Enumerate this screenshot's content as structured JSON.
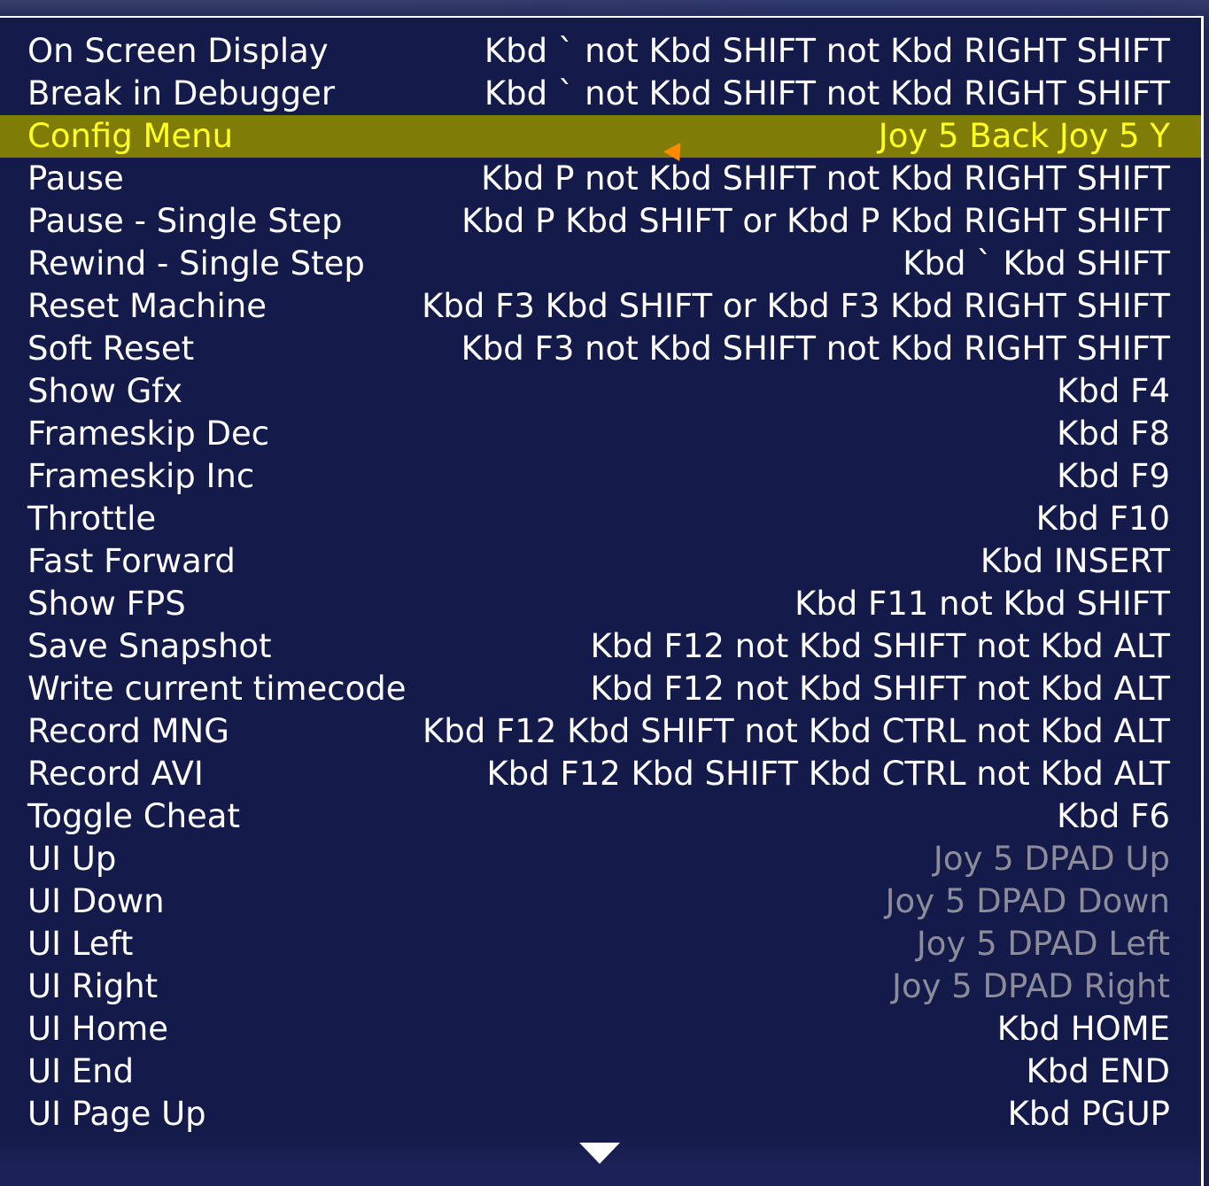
{
  "colors": {
    "panel_bg": "#141a49",
    "text": "#ffffff",
    "selected_bg": "#7f7d08",
    "selected_text": "#ffff22",
    "unassigned_text": "#8c8c9a",
    "pointer": "#ff8a00"
  },
  "menu": {
    "selected_index": 2,
    "items": [
      {
        "name": "On Screen Display",
        "binding": "Kbd ` not Kbd SHIFT not Kbd RIGHT SHIFT",
        "dim": false
      },
      {
        "name": "Break in Debugger",
        "binding": "Kbd ` not Kbd SHIFT not Kbd RIGHT SHIFT",
        "dim": false
      },
      {
        "name": "Config Menu",
        "binding": "Joy 5 Back Joy 5 Y",
        "dim": false
      },
      {
        "name": "Pause",
        "binding": "Kbd P not Kbd SHIFT not Kbd RIGHT SHIFT",
        "dim": false
      },
      {
        "name": "Pause - Single Step",
        "binding": "Kbd P Kbd SHIFT or Kbd P Kbd RIGHT SHIFT",
        "dim": false
      },
      {
        "name": "Rewind - Single Step",
        "binding": "Kbd ` Kbd SHIFT",
        "dim": false
      },
      {
        "name": "Reset Machine",
        "binding": "Kbd F3 Kbd SHIFT or Kbd F3 Kbd RIGHT SHIFT",
        "dim": false
      },
      {
        "name": "Soft Reset",
        "binding": "Kbd F3 not Kbd SHIFT not Kbd RIGHT SHIFT",
        "dim": false
      },
      {
        "name": "Show Gfx",
        "binding": "Kbd F4",
        "dim": false
      },
      {
        "name": "Frameskip Dec",
        "binding": "Kbd F8",
        "dim": false
      },
      {
        "name": "Frameskip Inc",
        "binding": "Kbd F9",
        "dim": false
      },
      {
        "name": "Throttle",
        "binding": "Kbd F10",
        "dim": false
      },
      {
        "name": "Fast Forward",
        "binding": "Kbd INSERT",
        "dim": false
      },
      {
        "name": "Show FPS",
        "binding": "Kbd F11 not Kbd SHIFT",
        "dim": false
      },
      {
        "name": "Save Snapshot",
        "binding": "Kbd F12 not Kbd SHIFT not Kbd ALT",
        "dim": false
      },
      {
        "name": "Write current timecode",
        "binding": "Kbd F12 not Kbd SHIFT not Kbd ALT",
        "dim": false
      },
      {
        "name": "Record MNG",
        "binding": "Kbd F12 Kbd SHIFT not Kbd CTRL not Kbd ALT",
        "dim": false
      },
      {
        "name": "Record AVI",
        "binding": "Kbd F12 Kbd SHIFT Kbd CTRL not Kbd ALT",
        "dim": false
      },
      {
        "name": "Toggle Cheat",
        "binding": "Kbd F6",
        "dim": false
      },
      {
        "name": "UI Up",
        "binding": "Joy 5 DPAD Up",
        "dim": true
      },
      {
        "name": "UI Down",
        "binding": "Joy 5 DPAD Down",
        "dim": true
      },
      {
        "name": "UI Left",
        "binding": "Joy 5 DPAD Left",
        "dim": true
      },
      {
        "name": "UI Right",
        "binding": "Joy 5 DPAD Right",
        "dim": true
      },
      {
        "name": "UI Home",
        "binding": "Kbd HOME",
        "dim": false
      },
      {
        "name": "UI End",
        "binding": "Kbd END",
        "dim": false
      },
      {
        "name": "UI Page Up",
        "binding": "Kbd PGUP",
        "dim": false
      }
    ]
  },
  "scroll": {
    "more_below_icon": "down-triangle-icon"
  }
}
